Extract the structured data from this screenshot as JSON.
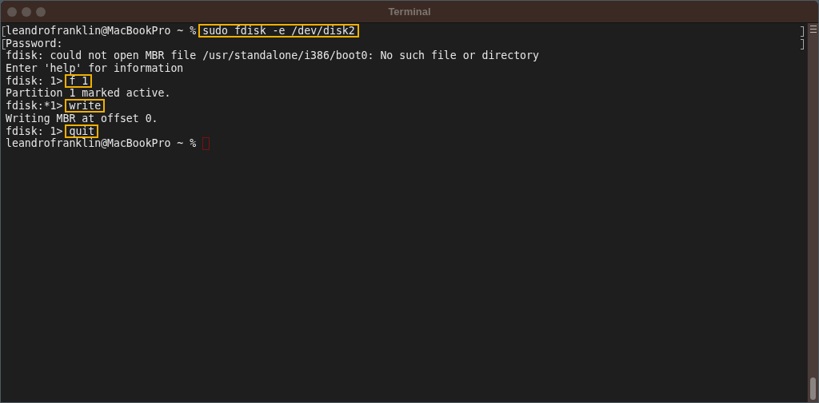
{
  "window": {
    "title": "Terminal"
  },
  "lines": [
    {
      "kind": "input",
      "prompt": "leandrofranklin@MacBookPro ~ %",
      "command": "sudo fdisk -e /dev/disk2",
      "highlighted": true,
      "marked": true
    },
    {
      "kind": "output",
      "text": "Password:",
      "marked": true
    },
    {
      "kind": "output",
      "text": "fdisk: could not open MBR file /usr/standalone/i386/boot0: No such file or directory",
      "marked": false
    },
    {
      "kind": "output",
      "text": "Enter 'help' for information",
      "marked": false
    },
    {
      "kind": "input",
      "prompt": "fdisk: 1>",
      "command": "f 1",
      "highlighted": true,
      "marked": false
    },
    {
      "kind": "output",
      "text": "Partition 1 marked active.",
      "marked": false
    },
    {
      "kind": "input",
      "prompt": "fdisk:*1>",
      "command": "write",
      "highlighted": true,
      "marked": false
    },
    {
      "kind": "output",
      "text": "Writing MBR at offset 0.",
      "marked": false
    },
    {
      "kind": "input",
      "prompt": "fdisk: 1>",
      "command": "quit",
      "highlighted": true,
      "marked": false
    },
    {
      "kind": "cursor",
      "prompt": "leandrofranklin@MacBookPro ~ %",
      "marked": false
    }
  ]
}
